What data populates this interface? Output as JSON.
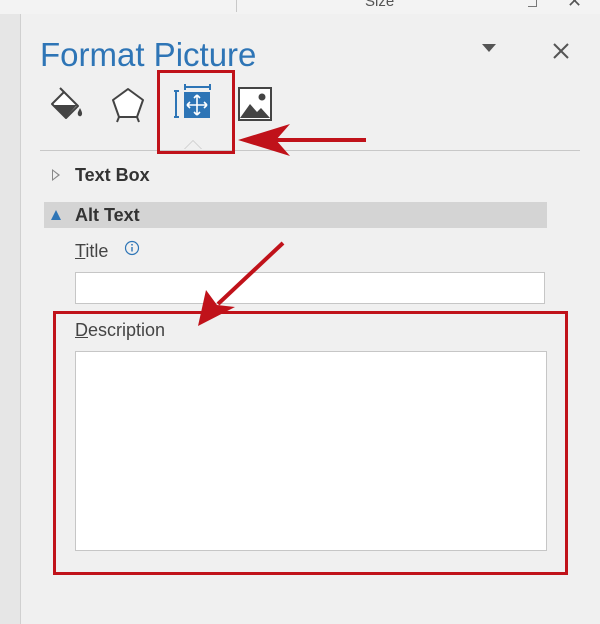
{
  "ribbon": {
    "size_label": "Size",
    "close_glyph": "✕"
  },
  "pane": {
    "title": "Format Picture",
    "menu_icon": "triangle-down-icon",
    "close_icon": "close-icon",
    "accent_color": "#2e75b6"
  },
  "tabs": [
    {
      "name": "Fill & Line",
      "icon": "paint-bucket-icon",
      "selected": false
    },
    {
      "name": "Effects",
      "icon": "pentagon-icon",
      "selected": false
    },
    {
      "name": "Size & Properties",
      "icon": "size-properties-icon",
      "selected": true
    },
    {
      "name": "Picture",
      "icon": "picture-icon",
      "selected": false
    }
  ],
  "sections": {
    "text_box": {
      "label": "Text Box",
      "expanded": false
    },
    "alt_text": {
      "label": "Alt Text",
      "expanded": true
    }
  },
  "fields": {
    "title": {
      "label_first": "T",
      "label_rest": "itle",
      "value": "",
      "info_icon": "info-icon"
    },
    "description": {
      "label_first": "D",
      "label_rest": "escription",
      "value": ""
    }
  },
  "annotations": {
    "color": "#c0121a"
  }
}
